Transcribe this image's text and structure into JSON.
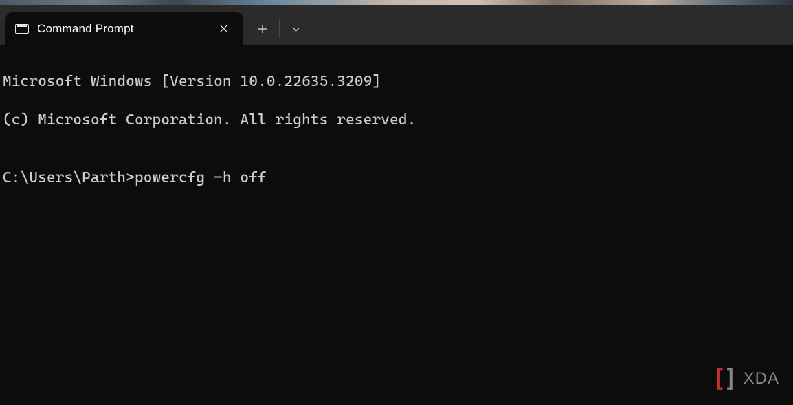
{
  "tab": {
    "title": "Command Prompt"
  },
  "terminal": {
    "line1": "Microsoft Windows [Version 10.0.22635.3209]",
    "line2": "(c) Microsoft Corporation. All rights reserved.",
    "blank": "",
    "prompt": "C:\\Users\\Parth>",
    "command": "powercfg -h off"
  },
  "watermark": {
    "text": "XDA"
  }
}
